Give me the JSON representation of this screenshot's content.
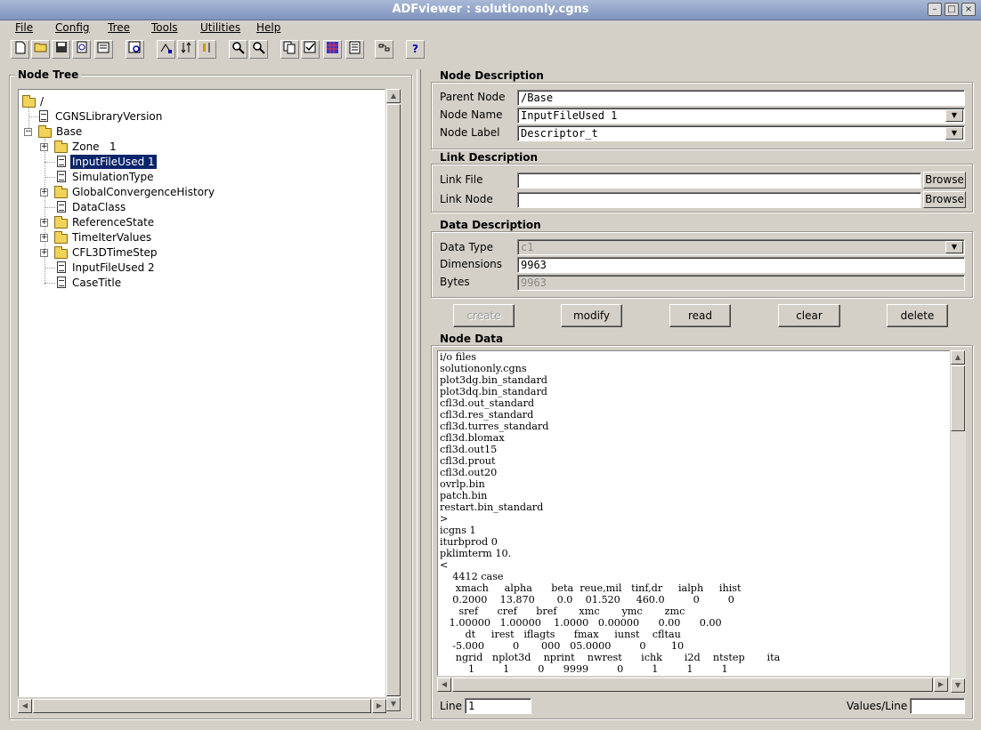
{
  "window": {
    "title": "ADFviewer : solutiononly.cgns",
    "controls": [
      "–",
      "□",
      "×"
    ]
  },
  "menubar": [
    "File",
    "Config",
    "Tree",
    "Tools",
    "Utilities",
    "Help"
  ],
  "toolbar": {
    "icons": [
      "new-file-icon",
      "open-folder-icon",
      "save-icon",
      "refresh-icon",
      "properties-icon",
      "find-node-icon",
      "expand-tree-icon",
      "sort-tree-icon",
      "collapse-tree-icon",
      "zoom-in-icon",
      "zoom-out-icon",
      "copy-node-icon",
      "check-icon",
      "grid-plot-icon",
      "table-icon",
      "link-icon",
      "help-icon"
    ],
    "help_glyph": "?"
  },
  "node_tree": {
    "title": "Node Tree",
    "nodes": [
      {
        "label": "/",
        "icon": "folder-icon"
      },
      {
        "label": "CGNSLibraryVersion",
        "icon": "document-icon"
      },
      {
        "label": "Base",
        "icon": "folder-icon"
      },
      {
        "label": "Zone   1",
        "icon": "folder-icon"
      },
      {
        "label": "InputFileUsed 1",
        "icon": "document-icon"
      },
      {
        "label": "SimulationType",
        "icon": "document-icon"
      },
      {
        "label": "GlobalConvergenceHistory",
        "icon": "folder-icon"
      },
      {
        "label": "DataClass",
        "icon": "document-icon"
      },
      {
        "label": "ReferenceState",
        "icon": "folder-icon"
      },
      {
        "label": "TimeIterValues",
        "icon": "folder-icon"
      },
      {
        "label": "CFL3DTimeStep",
        "icon": "folder-icon"
      },
      {
        "label": "InputFileUsed 2",
        "icon": "document-icon"
      },
      {
        "label": "CaseTitle",
        "icon": "document-icon"
      }
    ],
    "selected": "InputFileUsed 1",
    "expand_glyph": "+",
    "collapse_glyph": "−"
  },
  "node_description": {
    "title": "Node Description",
    "parent_node_label": "Parent Node",
    "parent_node_value": "/Base",
    "node_name_label": "Node Name",
    "node_name_value": "InputFileUsed 1",
    "node_label_label": "Node Label",
    "node_label_value": "Descriptor_t"
  },
  "link_description": {
    "title": "Link Description",
    "link_file_label": "Link File",
    "link_file_value": "",
    "link_node_label": "Link Node",
    "link_node_value": "",
    "browse_label": "Browse"
  },
  "data_description": {
    "title": "Data Description",
    "data_type_label": "Data Type",
    "data_type_value": "c1",
    "dimensions_label": "Dimensions",
    "dimensions_value": "9963",
    "bytes_label": "Bytes",
    "bytes_value": "9963"
  },
  "actions": {
    "create": "create",
    "modify": "modify",
    "read": "read",
    "clear": "clear",
    "delete": "delete"
  },
  "node_data": {
    "title": "Node Data",
    "text": "i/o files\nsolutiononly.cgns\nplot3dg.bin_standard\nplot3dq.bin_standard\ncfl3d.out_standard\ncfl3d.res_standard\ncfl3d.turres_standard\ncfl3d.blomax\ncfl3d.out15\ncfl3d.prout\ncfl3d.out20\novrlp.bin\npatch.bin\nrestart.bin_standard\n>\nicgns 1\niturbprod 0\npklimterm 10.\n<\n    4412 case\n     xmach     alpha      beta  reue,mil   tinf,dr     ialph     ihist\n    0.2000    13.870       0.0    01.520     460.0         0         0\n      sref      cref      bref       xmc       ymc       zmc\n   1.00000   1.00000    1.0000   0.00000      0.00      0.00\n        dt     irest   iflagts      fmax     iunst    cfltau\n    -5.000         0       000   05.0000         0        10\n     ngrid   nplot3d    nprint    nwrest      ichk       i2d    ntstep       ita\n         1         1         0      9999         0         1         1         1",
    "line_label": "Line",
    "line_value": "1",
    "values_per_line_label": "Values/Line",
    "values_per_line_value": ""
  }
}
